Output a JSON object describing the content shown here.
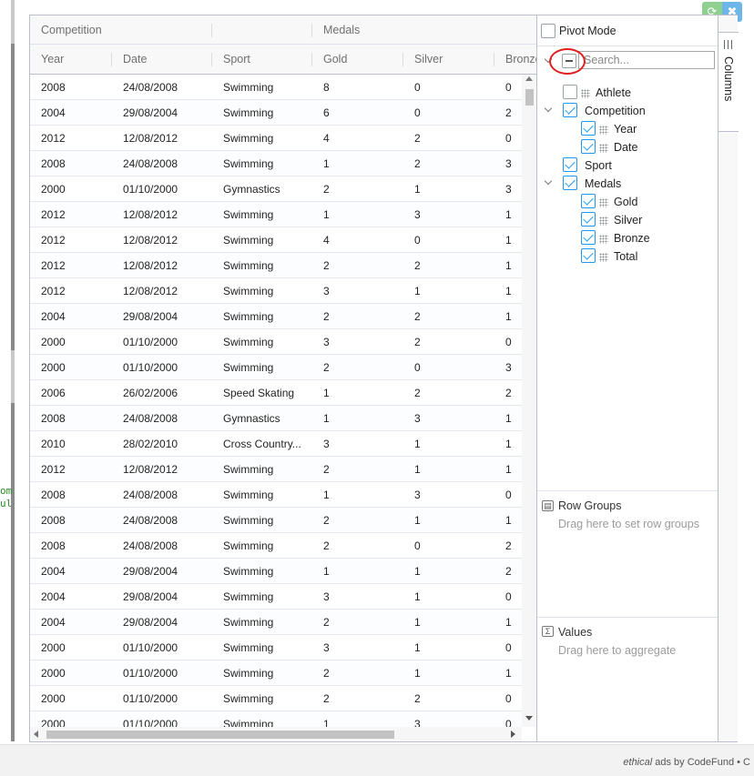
{
  "editor": {
    "code_fragments": [
      "om",
      "ul"
    ]
  },
  "grid": {
    "group_headers": [
      {
        "label": "Competition"
      },
      {
        "label": ""
      },
      {
        "label": "Medals"
      }
    ],
    "columns": [
      "Year",
      "Date",
      "Sport",
      "Gold",
      "Silver",
      "Bronze"
    ],
    "rows": [
      [
        "2008",
        "24/08/2008",
        "Swimming",
        "8",
        "0",
        "0"
      ],
      [
        "2004",
        "29/08/2004",
        "Swimming",
        "6",
        "0",
        "2"
      ],
      [
        "2012",
        "12/08/2012",
        "Swimming",
        "4",
        "2",
        "0"
      ],
      [
        "2008",
        "24/08/2008",
        "Swimming",
        "1",
        "2",
        "3"
      ],
      [
        "2000",
        "01/10/2000",
        "Gymnastics",
        "2",
        "1",
        "3"
      ],
      [
        "2012",
        "12/08/2012",
        "Swimming",
        "1",
        "3",
        "1"
      ],
      [
        "2012",
        "12/08/2012",
        "Swimming",
        "4",
        "0",
        "1"
      ],
      [
        "2012",
        "12/08/2012",
        "Swimming",
        "2",
        "2",
        "1"
      ],
      [
        "2012",
        "12/08/2012",
        "Swimming",
        "3",
        "1",
        "1"
      ],
      [
        "2004",
        "29/08/2004",
        "Swimming",
        "2",
        "2",
        "1"
      ],
      [
        "2000",
        "01/10/2000",
        "Swimming",
        "3",
        "2",
        "0"
      ],
      [
        "2000",
        "01/10/2000",
        "Swimming",
        "2",
        "0",
        "3"
      ],
      [
        "2006",
        "26/02/2006",
        "Speed Skating",
        "1",
        "2",
        "2"
      ],
      [
        "2008",
        "24/08/2008",
        "Gymnastics",
        "1",
        "3",
        "1"
      ],
      [
        "2010",
        "28/02/2010",
        "Cross Country...",
        "3",
        "1",
        "1"
      ],
      [
        "2012",
        "12/08/2012",
        "Swimming",
        "2",
        "1",
        "1"
      ],
      [
        "2008",
        "24/08/2008",
        "Swimming",
        "1",
        "3",
        "0"
      ],
      [
        "2008",
        "24/08/2008",
        "Swimming",
        "2",
        "1",
        "1"
      ],
      [
        "2008",
        "24/08/2008",
        "Swimming",
        "2",
        "0",
        "2"
      ],
      [
        "2004",
        "29/08/2004",
        "Swimming",
        "1",
        "1",
        "2"
      ],
      [
        "2004",
        "29/08/2004",
        "Swimming",
        "3",
        "1",
        "0"
      ],
      [
        "2004",
        "29/08/2004",
        "Swimming",
        "2",
        "1",
        "1"
      ],
      [
        "2000",
        "01/10/2000",
        "Swimming",
        "3",
        "1",
        "0"
      ],
      [
        "2000",
        "01/10/2000",
        "Swimming",
        "2",
        "1",
        "1"
      ],
      [
        "2000",
        "01/10/2000",
        "Swimming",
        "2",
        "2",
        "0"
      ],
      [
        "2000",
        "01/10/2000",
        "Swimming",
        "1",
        "3",
        "0"
      ]
    ]
  },
  "tool_panel": {
    "pivot_mode_label": "Pivot Mode",
    "search_placeholder": "Search...",
    "column_tree": [
      {
        "label": "Athlete",
        "checked": false,
        "level": 1,
        "group": false
      },
      {
        "label": "Competition",
        "checked": true,
        "level": 0,
        "group": true
      },
      {
        "label": "Year",
        "checked": true,
        "level": 2,
        "group": false
      },
      {
        "label": "Date",
        "checked": true,
        "level": 2,
        "group": false
      },
      {
        "label": "Sport",
        "checked": true,
        "level": 1,
        "group": false,
        "no_grip": true
      },
      {
        "label": "Medals",
        "checked": true,
        "level": 0,
        "group": true
      },
      {
        "label": "Gold",
        "checked": true,
        "level": 2,
        "group": false
      },
      {
        "label": "Silver",
        "checked": true,
        "level": 2,
        "group": false
      },
      {
        "label": "Bronze",
        "checked": true,
        "level": 2,
        "group": false
      },
      {
        "label": "Total",
        "checked": true,
        "level": 2,
        "group": false
      }
    ],
    "row_groups": {
      "title": "Row Groups",
      "hint": "Drag here to set row groups"
    },
    "values": {
      "title": "Values",
      "hint": "Drag here to aggregate"
    }
  },
  "side_bar": {
    "tab_label": "Columns"
  },
  "footer": {
    "ad_prefix": "ethical",
    "ad_text": " ads by CodeFund • C"
  },
  "colors": {
    "accent": "#2196f3",
    "border": "#babfc7",
    "highlight": "#e02020"
  }
}
